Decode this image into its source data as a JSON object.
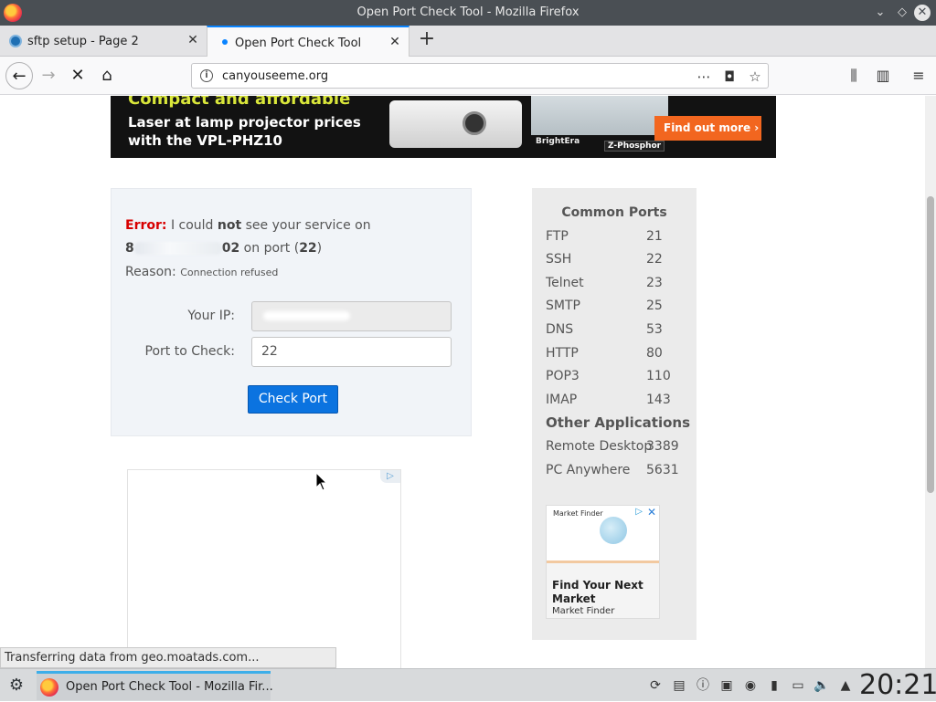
{
  "window": {
    "title": "Open Port Check Tool - Mozilla Firefox"
  },
  "tabs": [
    {
      "label": "sftp setup - Page 2",
      "active": false
    },
    {
      "label": "Open Port Check Tool",
      "active": true
    }
  ],
  "navbar": {
    "url": "canyouseeme.org"
  },
  "banner": {
    "headline": "Compact and affordable",
    "line1": "Laser at lamp projector prices",
    "line2": "with the VPL-PHZ10",
    "logos": "BrightEra",
    "zphosphor": "Z-Phosphor",
    "cta": "Find out more  ›"
  },
  "check": {
    "error_label": "Error:",
    "msg_part1": " I could ",
    "msg_not": "not",
    "msg_part2": " see your service on",
    "ip_lead": "8",
    "ip_tail": "02",
    "on_port_text": " on port (",
    "port_number": "22",
    "on_port_close": ")",
    "reason_label": "Reason:",
    "reason_value": "Connection refused",
    "your_ip_label": "Your IP:",
    "your_ip_value": "",
    "port_label": "Port to Check:",
    "port_value": "22",
    "button_label": "Check Port"
  },
  "common_ports": {
    "title": "Common Ports",
    "rows": [
      {
        "name": "FTP",
        "port": "21"
      },
      {
        "name": "SSH",
        "port": "22"
      },
      {
        "name": "Telnet",
        "port": "23"
      },
      {
        "name": "SMTP",
        "port": "25"
      },
      {
        "name": "DNS",
        "port": "53"
      },
      {
        "name": "HTTP",
        "port": "80"
      },
      {
        "name": "POP3",
        "port": "110"
      },
      {
        "name": "IMAP",
        "port": "143"
      }
    ],
    "other_title": "Other Applications",
    "other_rows": [
      {
        "name": "Remote Desktop",
        "port": "3389"
      },
      {
        "name": "PC Anywhere",
        "port": "5631"
      }
    ]
  },
  "side_ad": {
    "brand": "Market Finder",
    "title": "Find Your Next Market",
    "source": "Market Finder"
  },
  "status": {
    "text": "Transferring data from geo.moatads.com..."
  },
  "taskbar": {
    "task_label": "Open Port Check Tool - Mozilla Fir...",
    "clock": "20:21"
  },
  "colors": {
    "accent": "#0b73e0",
    "error": "#d80000",
    "tab_highlight": "#0a84ff"
  }
}
